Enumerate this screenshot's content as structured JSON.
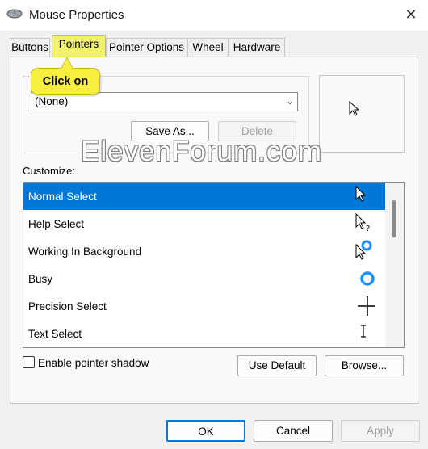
{
  "window": {
    "title": "Mouse Properties",
    "close_glyph": "✕"
  },
  "tabs": [
    {
      "label": "Buttons",
      "active": false
    },
    {
      "label": "Pointers",
      "active": true
    },
    {
      "label": "Pointer Options",
      "active": false
    },
    {
      "label": "Wheel",
      "active": false
    },
    {
      "label": "Hardware",
      "active": false
    }
  ],
  "callout": {
    "text": "Click on"
  },
  "scheme": {
    "selected": "(None)",
    "save_as_label": "Save As...",
    "delete_label": "Delete"
  },
  "watermark": "ElevenForum.com",
  "customize": {
    "label": "Customize:",
    "items": [
      {
        "label": "Normal Select",
        "icon": "arrow-cursor-icon",
        "selected": true
      },
      {
        "label": "Help Select",
        "icon": "help-cursor-icon",
        "selected": false
      },
      {
        "label": "Working In Background",
        "icon": "working-cursor-icon",
        "selected": false
      },
      {
        "label": "Busy",
        "icon": "busy-cursor-icon",
        "selected": false
      },
      {
        "label": "Precision Select",
        "icon": "crosshair-cursor-icon",
        "selected": false
      },
      {
        "label": "Text Select",
        "icon": "ibeam-cursor-icon",
        "selected": false
      }
    ]
  },
  "shadow": {
    "label": "Enable pointer shadow",
    "checked": false
  },
  "actions": {
    "use_default_label": "Use Default",
    "browse_label": "Browse..."
  },
  "footer": {
    "ok_label": "OK",
    "cancel_label": "Cancel",
    "apply_label": "Apply"
  },
  "colors": {
    "selection": "#0078d7",
    "callout": "#f7ee3f",
    "busy_ring": "#1e90ff"
  }
}
